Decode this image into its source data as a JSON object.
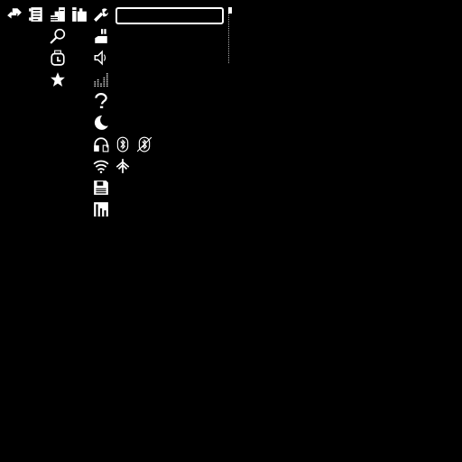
{
  "toolbar": {
    "icons": [
      "swap-icon",
      "document-icon",
      "stats-icon",
      "books-icon",
      "wrench-icon"
    ]
  },
  "search": {
    "value": ""
  },
  "colors": {
    "background": "#000000",
    "foreground": "#ffffff"
  }
}
